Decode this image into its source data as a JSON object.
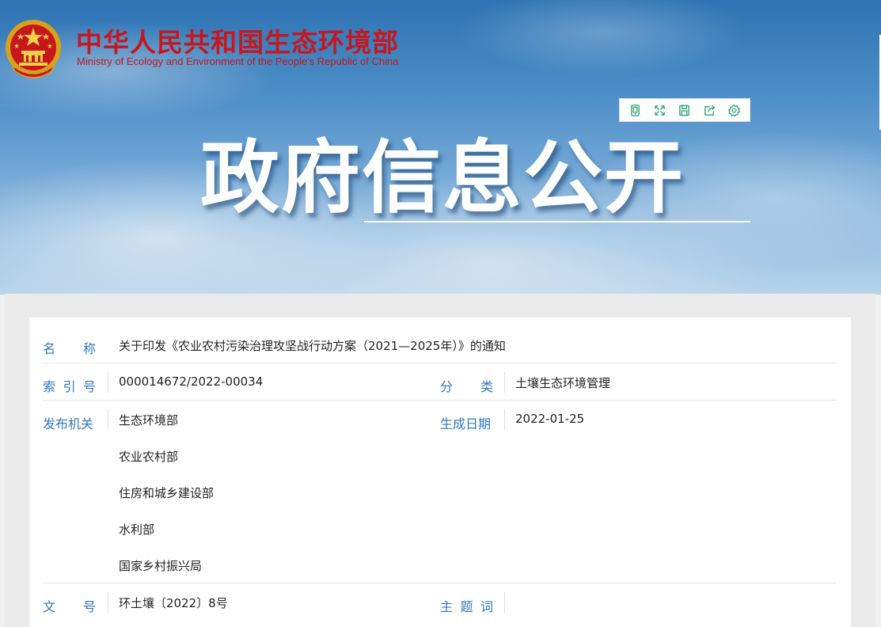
{
  "header": {
    "ministry_cn": "中华人民共和国生态环境部",
    "ministry_en": "Ministry of Ecology and Environment of the People's Republic of China",
    "emblem_icon": "national-emblem-icon",
    "title": "政府信息公开",
    "colors": {
      "ministry_red": "#c8161d",
      "sky_blue": "#4a8cc6",
      "toolbar_green": "#2aa37a"
    }
  },
  "toolbar": {
    "buttons": [
      {
        "icon": "mobile-icon"
      },
      {
        "icon": "fullscreen-icon"
      },
      {
        "icon": "save-icon"
      },
      {
        "icon": "share-icon"
      },
      {
        "icon": "settings-icon"
      }
    ]
  },
  "info": {
    "name": {
      "label_chars": [
        "名",
        "称"
      ],
      "value": "关于印发《农业农村污染治理攻坚战行动方案（2021—2025年）》的通知"
    },
    "index": {
      "label_chars": [
        "索",
        "引",
        "号"
      ],
      "value": "000014672/2022-00034"
    },
    "category": {
      "label_chars": [
        "分",
        "类"
      ],
      "value": "土壤生态环境管理"
    },
    "issuer": {
      "label": "发布机关",
      "values": [
        "生态环境部",
        "农业农村部",
        "住房和城乡建设部",
        "水利部",
        "国家乡村振兴局"
      ]
    },
    "date": {
      "label": "生成日期",
      "value": "2022-01-25"
    },
    "doc_no": {
      "label_chars": [
        "文",
        "号"
      ],
      "value": "环土壤〔2022〕8号"
    },
    "keywords": {
      "label_chars": [
        "主",
        "题",
        "词"
      ],
      "value": ""
    },
    "colors": {
      "label_blue": "#2f78c4",
      "value_text": "#222222"
    }
  }
}
